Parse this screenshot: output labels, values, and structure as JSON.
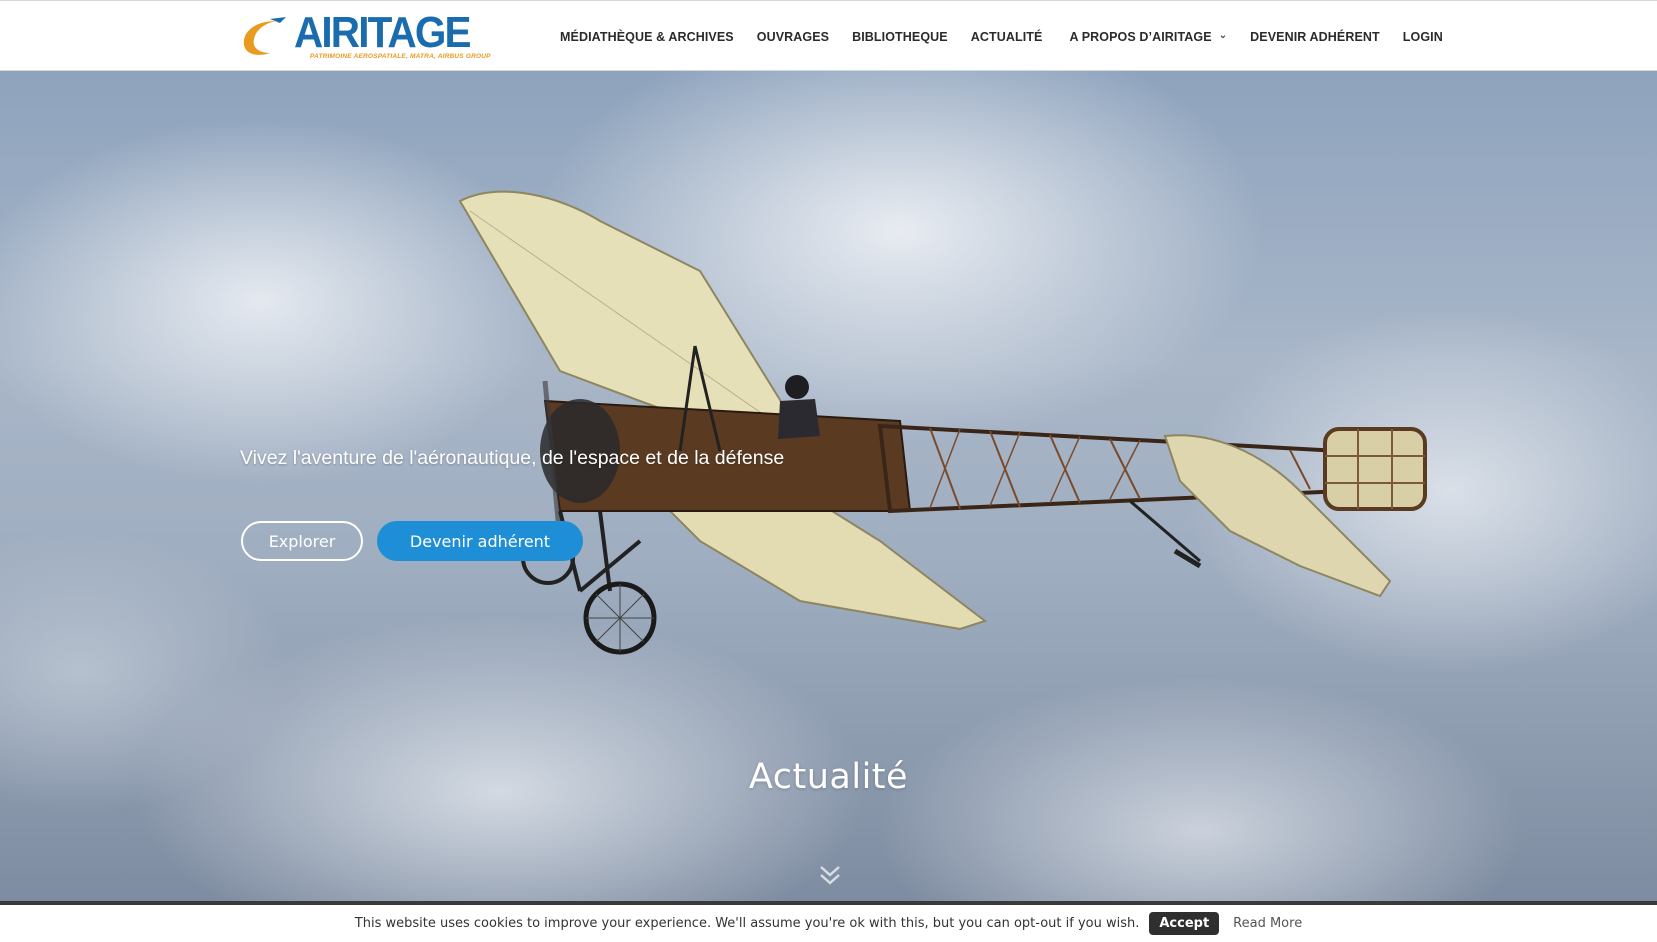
{
  "header": {
    "logo": {
      "wordmark": "AIRitage",
      "tagline": "PATRIMOINE AEROSPATIALE, MATRA, AIRBUS GROUP"
    },
    "nav": [
      {
        "label": "MÉDIATHÈQUE & ARCHIVES"
      },
      {
        "label": "OUVRAGES"
      },
      {
        "label": "BIBLIOTHEQUE"
      },
      {
        "label": "ACTUALITÉ"
      },
      {
        "label": "A PROPOS D’AIRITAGE",
        "has_dropdown": true
      },
      {
        "label": "DEVENIR ADHÉRENT"
      },
      {
        "label": "LOGIN"
      }
    ],
    "dropdown_icon": "chevron-down-icon"
  },
  "hero": {
    "tagline": "Vivez l'aventure de l'aéronautique, de l'espace et de la défense",
    "buttons": {
      "explore": "Explorer",
      "join": "Devenir adhérent"
    },
    "image": "vintage-monoplane-in-cloudy-sky",
    "section_title": "Actualité",
    "scroll_icon": "double-chevron-down-icon"
  },
  "cookie_bar": {
    "text": "This website uses cookies to improve your experience. We'll assume you're ok with this, but you can opt-out if you wish.",
    "accept": "Accept",
    "read_more": "Read More"
  },
  "colors": {
    "brand_blue": "#1a6cae",
    "brand_orange": "#e89a21",
    "button_blue": "#1e8fd6",
    "cookie_border": "#3a3a3a"
  }
}
